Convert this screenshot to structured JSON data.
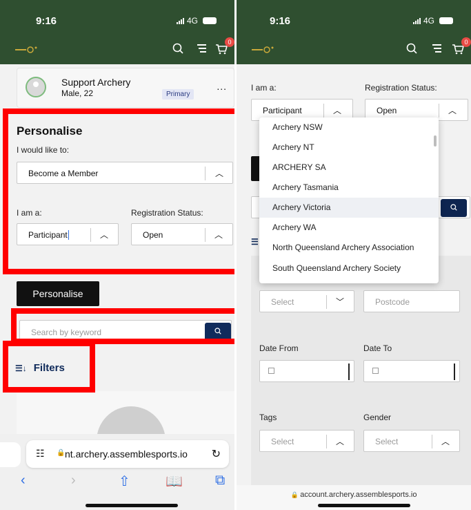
{
  "left": {
    "status": {
      "time": "9:16",
      "network": "4G"
    },
    "cart_count": "0",
    "profile": {
      "name": "Support Archery",
      "sub": "Male, 22",
      "badge": "Primary",
      "more": "..."
    },
    "personalise": {
      "heading": "Personalise",
      "would_like_label": "I would like to:",
      "would_like_value": "Become a Member",
      "iam_label": "I am a:",
      "iam_value": "Participant",
      "reg_label": "Registration Status:",
      "reg_value": "Open"
    },
    "personalise_button": "Personalise",
    "search_placeholder": "Search by keyword",
    "filters_label": "Filters",
    "safari": {
      "url": "nt.archery.assemblesports.io"
    }
  },
  "right": {
    "status": {
      "time": "9:16",
      "network": "4G"
    },
    "cart_count": "0",
    "iam_label": "I am a:",
    "iam_value": "Participant",
    "reg_label": "Registration Status:",
    "reg_value": "Open",
    "dropdown_items": [
      "Archery NSW",
      "Archery NT",
      "ARCHERY SA",
      "Archery Tasmania",
      "Archery Victoria",
      "Archery WA",
      "North Queensland Archery Association",
      "South Queensland Archery Society"
    ],
    "dropdown_selected": "Archery Victoria",
    "select_placeholder": "Select",
    "postcode_placeholder": "Postcode",
    "date_from_label": "Date From",
    "date_to_label": "Date To",
    "tags_label": "Tags",
    "tags_placeholder": "Select",
    "gender_label": "Gender",
    "gender_placeholder": "Select",
    "footer_url": "account.archery.assemblesports.io"
  },
  "icons": {
    "search": "search-icon",
    "menu": "menu-icon",
    "cart": "cart-icon",
    "chevron_up": "chevron-up-icon",
    "chevron_down": "chevron-down-icon",
    "filter": "filter-icon",
    "calendar": "calendar-icon"
  },
  "colors": {
    "header_green": "#2f4f30",
    "highlight_red": "#ff0000",
    "navy": "#102b5c",
    "ios_blue": "#2f6fe4"
  }
}
